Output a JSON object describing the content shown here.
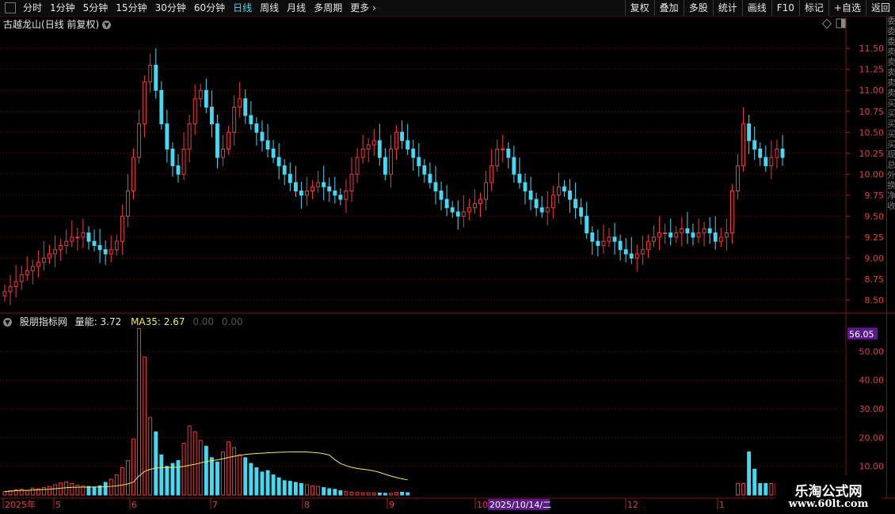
{
  "toolbar": {
    "period_tabs": [
      "分时",
      "1分钟",
      "5分钟",
      "15分钟",
      "30分钟",
      "60分钟",
      "日线",
      "周线",
      "月线",
      "多周期",
      "更多"
    ],
    "active_tab": "日线",
    "more_label": "更多",
    "tools": [
      "复权",
      "叠加",
      "多股",
      "统计",
      "画线",
      "F10",
      "标记",
      "+自选",
      "返回"
    ]
  },
  "price_chart": {
    "stock_name": "古越龙山",
    "mode": "(日线 前复权)",
    "price_axis": [
      "11.50",
      "11.25",
      "11.00",
      "10.75",
      "10.50",
      "10.25",
      "10.00",
      "9.75",
      "9.50",
      "9.25",
      "9.00",
      "8.75",
      "8.50"
    ]
  },
  "volume_panel": {
    "indicator_name": "股朋指标网",
    "volume_label": "量能: 3.72",
    "ma_label": "MA35: 2.67",
    "series_3": "0.00",
    "series_4": "0.00",
    "current_value": "56.05",
    "axis_labels": [
      "50.00",
      "40.00",
      "30.00",
      "20.00",
      "10.00"
    ]
  },
  "date_axis": {
    "labels": [
      "2025年",
      "5",
      "6",
      "7",
      "8",
      "9",
      "10",
      "12",
      "1"
    ],
    "cursor_date": "2025/10/14/二"
  },
  "right_strip": {
    "chars": [
      "委",
      "委",
      "委",
      "卖",
      "卖",
      "卖",
      "卖",
      "卖",
      "买",
      "买",
      "买",
      "买",
      "买",
      "现",
      "总",
      "外",
      "换",
      "净",
      "收"
    ]
  },
  "watermark": {
    "line1": "乐淘公式网",
    "line2": "www.60lt.com"
  },
  "colors": {
    "up": "#f23a3a",
    "down": "#45d8f2",
    "ma": "#f0f04a",
    "background": "#000000",
    "active": "#45d8f2",
    "highlight": "#5b1a8c"
  },
  "chart_data": {
    "type": "candlestick",
    "x_range": [
      "2025-04-01",
      "2026-01-10"
    ],
    "ylim": [
      8.4,
      11.7
    ],
    "closes": [
      8.6,
      8.66,
      8.72,
      8.8,
      8.85,
      8.9,
      8.95,
      9.0,
      9.05,
      9.1,
      9.15,
      9.2,
      9.25,
      9.25,
      9.3,
      9.2,
      9.15,
      9.1,
      9.05,
      9.1,
      9.2,
      9.5,
      9.8,
      10.2,
      10.6,
      11.1,
      11.3,
      11.0,
      10.6,
      10.3,
      10.1,
      10.0,
      10.3,
      10.6,
      10.9,
      11.0,
      10.8,
      10.6,
      10.2,
      10.3,
      10.5,
      10.8,
      10.9,
      10.7,
      10.6,
      10.5,
      10.4,
      10.3,
      10.2,
      10.1,
      10.0,
      9.9,
      9.8,
      9.75,
      9.8,
      9.85,
      9.9,
      9.85,
      9.8,
      9.75,
      9.7,
      9.8,
      10.0,
      10.2,
      10.3,
      10.35,
      10.4,
      10.2,
      10.0,
      10.3,
      10.5,
      10.4,
      10.3,
      10.2,
      10.1,
      10.0,
      9.9,
      9.8,
      9.7,
      9.6,
      9.55,
      9.5,
      9.55,
      9.6,
      9.65,
      9.7,
      9.9,
      10.1,
      10.3,
      10.3,
      10.2,
      10.0,
      9.9,
      9.8,
      9.7,
      9.6,
      9.55,
      9.6,
      9.75,
      9.85,
      9.8,
      9.7,
      9.6,
      9.5,
      9.3,
      9.2,
      9.15,
      9.2,
      9.25,
      9.2,
      9.1,
      9.05,
      9.0,
      9.05,
      9.1,
      9.2,
      9.25,
      9.3,
      9.3,
      9.25,
      9.3,
      9.35,
      9.3,
      9.25,
      9.3,
      9.35,
      9.3,
      9.2,
      9.25,
      9.3,
      9.8,
      10.1,
      10.6,
      10.4,
      10.3,
      10.2,
      10.1,
      10.2,
      10.3,
      10.2
    ],
    "volume": {
      "ylim": [
        0,
        60
      ],
      "values": [
        1.2,
        1.5,
        1.8,
        2.0,
        1.6,
        2.4,
        2.2,
        2.6,
        3.0,
        3.6,
        4.2,
        4.6,
        4.0,
        3.4,
        3.2,
        3.0,
        2.8,
        3.2,
        4.4,
        5.5,
        7.0,
        9.5,
        12.0,
        19.5,
        58.0,
        48.0,
        27.0,
        22.0,
        14.0,
        10.0,
        11.0,
        12.0,
        18.0,
        24.0,
        22.0,
        19.0,
        17.0,
        13.0,
        11.5,
        15.0,
        18.5,
        16.5,
        14.0,
        13.0,
        11.0,
        9.5,
        8.0,
        8.5,
        7.0,
        6.0,
        5.0,
        4.8,
        4.4,
        4.0,
        3.6,
        3.2,
        3.0,
        2.6,
        2.2,
        2.0,
        1.5,
        1.2,
        1.0,
        0.9,
        0.8,
        0.8,
        0.7,
        0.7,
        0.6,
        0.6,
        0.9,
        1.0,
        0.8
      ],
      "ma_series_label": "MA35"
    }
  }
}
